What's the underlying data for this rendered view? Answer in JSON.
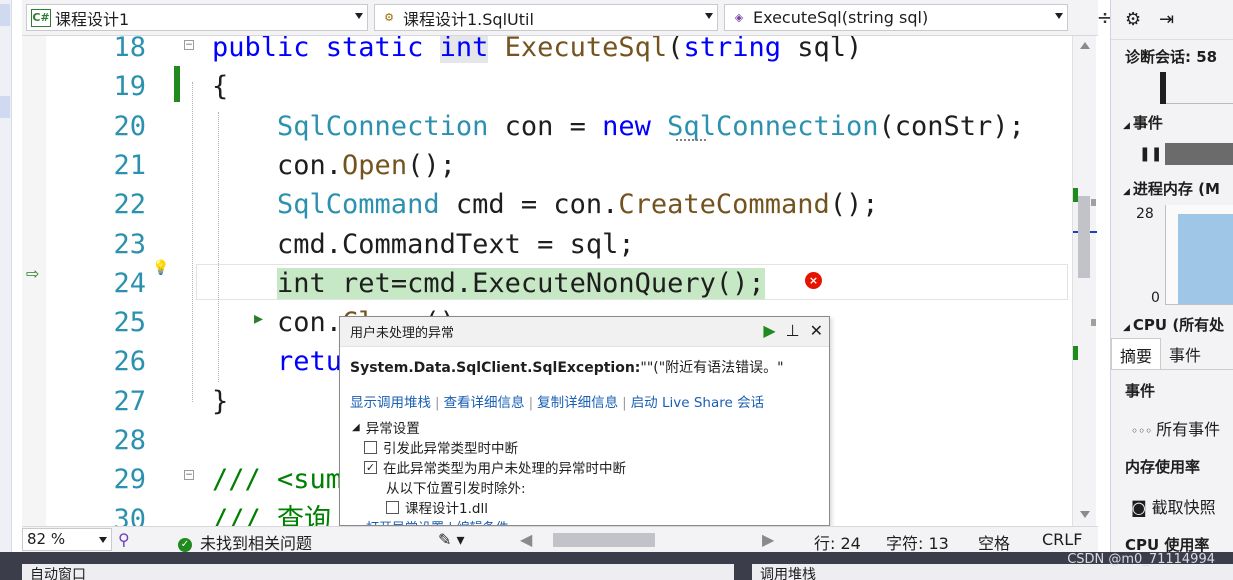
{
  "navbar": {
    "project": "课程设计1",
    "project_icon": "C#",
    "class": "课程设计1.SqlUtil",
    "member": "ExecuteSql(string sql)"
  },
  "code_lines": [
    {
      "num": "18",
      "tokens": [
        {
          "t": "public static ",
          "c": "kw"
        },
        {
          "t": "int",
          "c": "kw hl-int"
        },
        {
          "t": " ExecuteSql",
          "c": "mt"
        },
        {
          "t": "(",
          "c": "tx"
        },
        {
          "t": "string",
          "c": "kw"
        },
        {
          "t": " sql)",
          "c": "tx"
        }
      ]
    },
    {
      "num": "19",
      "tokens": [
        {
          "t": "{",
          "c": "tx"
        }
      ]
    },
    {
      "num": "20",
      "tokens": [
        {
          "t": "    SqlConnection",
          "c": "ty"
        },
        {
          "t": " con = ",
          "c": "tx"
        },
        {
          "t": "new",
          "c": "kw"
        },
        {
          "t": " SqlConnection",
          "c": "ty"
        },
        {
          "t": "(conStr);",
          "c": "tx"
        }
      ]
    },
    {
      "num": "21",
      "tokens": [
        {
          "t": "    con.",
          "c": "tx"
        },
        {
          "t": "Open",
          "c": "mt"
        },
        {
          "t": "();",
          "c": "tx"
        }
      ]
    },
    {
      "num": "22",
      "tokens": [
        {
          "t": "    SqlCommand",
          "c": "ty"
        },
        {
          "t": " cmd = con.",
          "c": "tx"
        },
        {
          "t": "CreateCommand",
          "c": "mt"
        },
        {
          "t": "();",
          "c": "tx"
        }
      ]
    },
    {
      "num": "23",
      "tokens": [
        {
          "t": "    cmd.CommandText = sql;",
          "c": "tx"
        }
      ]
    },
    {
      "num": "24",
      "tokens": [
        {
          "t": "    ",
          "c": "tx"
        },
        {
          "t": "int ret=cmd.ExecuteNonQuery();",
          "c": "tx err-hl"
        }
      ]
    },
    {
      "num": "25",
      "tokens": [
        {
          "t": "    con.",
          "c": "tx"
        },
        {
          "t": "Cl",
          "c": "mt"
        },
        {
          "t": "   ()",
          "c": "tx"
        }
      ]
    },
    {
      "num": "26",
      "tokens": [
        {
          "t": "    retu",
          "c": "kw"
        }
      ]
    },
    {
      "num": "27",
      "tokens": [
        {
          "t": "}",
          "c": "tx"
        }
      ]
    },
    {
      "num": "28",
      "tokens": [
        {
          "t": "",
          "c": "tx"
        }
      ]
    },
    {
      "num": "29",
      "tokens": [
        {
          "t": "/// <sum",
          "c": "cm"
        }
      ]
    },
    {
      "num": "30",
      "tokens": [
        {
          "t": "/// 查询",
          "c": "cm"
        }
      ]
    }
  ],
  "exception": {
    "title": "用户未处理的异常",
    "message_bold": "System.Data.SqlClient.SqlException:",
    "message_rest": "\"\"(\"附近有语法错误。\"",
    "links": [
      "显示调用堆栈",
      "查看详细信息",
      "复制详细信息",
      "启动 Live Share 会话"
    ],
    "settings_title": "异常设置",
    "opt1": "引发此异常类型时中断",
    "opt1_checked": false,
    "opt2": "在此异常类型为用户未处理的异常时中断",
    "opt2_checked": true,
    "except_label": "从以下位置引发时除外:",
    "dll": "课程设计1.dll",
    "dll_checked": false,
    "more_links": "打开异常设置 | 编辑条件"
  },
  "statusbar": {
    "zoom": "82 %",
    "issues": "未找到相关问题",
    "line": "行: 24",
    "char": "字符: 13",
    "ws": "空格",
    "eol": "CRLF"
  },
  "bottom": {
    "left_tab": "自动窗口",
    "right_tab": "调用堆栈",
    "watermark": "CSDN @m0_71114994"
  },
  "diagnostics": {
    "session": "诊断会话: 58",
    "events": "事件",
    "memory": "进程内存 (M",
    "axis_top": "28",
    "axis_bottom": "0",
    "cpu": "CPU (所有处",
    "tab_summary": "摘要",
    "tab_events": "事件",
    "sec_events": "事件",
    "all_events": "所有事件",
    "sec_memory": "内存使用率",
    "snapshot": "截取快照",
    "sec_cpu": "CPU 使用率"
  },
  "colors": {
    "keyword": "#0000ff",
    "type": "#2b91af",
    "method": "#74531f",
    "comment": "#008000",
    "error_line": "#c7e8c4",
    "link": "#1a5fb4"
  }
}
